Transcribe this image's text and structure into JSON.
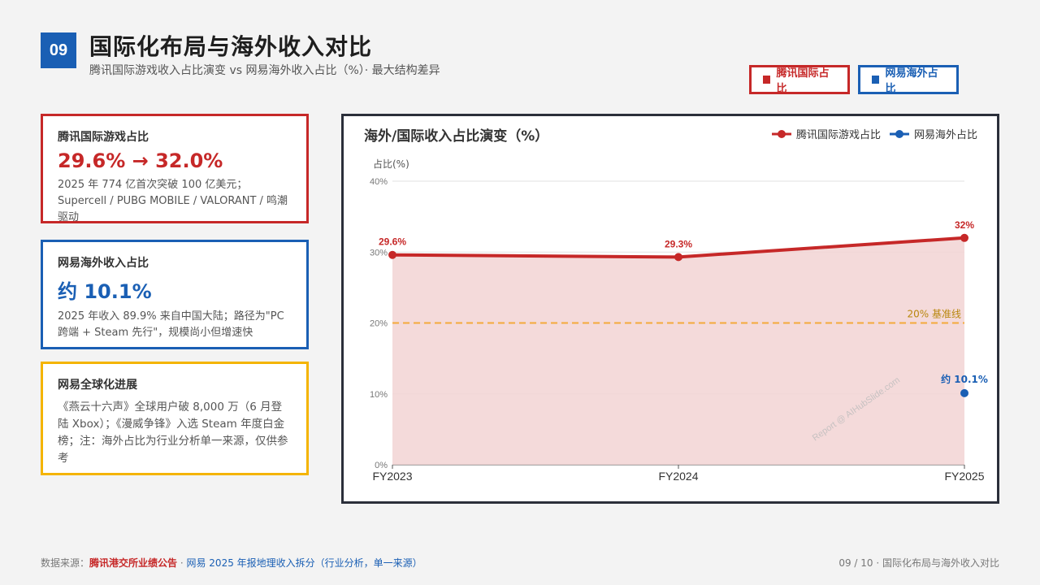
{
  "header": {
    "page_number": "09",
    "title": "国际化布局与海外收入对比",
    "subtitle": "腾讯国际游戏收入占比演变 vs 网易海外收入占比（%）· 最大结构差异"
  },
  "legend_boxes": {
    "tencent": "腾讯国际占比",
    "netease": "网易海外占比"
  },
  "cards": [
    {
      "title": "腾讯国际游戏占比",
      "value": "29.6% → 32.0%",
      "desc": "2025 年 774 亿首次突破 100 亿美元；Supercell / PUBG MOBILE / VALORANT / 鸣潮驱动"
    },
    {
      "title": "网易海外收入占比",
      "value": "约 10.1%",
      "desc": "2025 年收入 89.9% 来自中国大陆；路径为\"PC 跨端 + Steam 先行\"，规模尚小但增速快"
    },
    {
      "title": "网易全球化进展",
      "desc": "《燕云十六声》全球用户破 8,000 万（6 月登陆 Xbox）；《漫威争锋》入选 Steam 年度白金榜；注：海外占比为行业分析单一来源，仅供参考"
    }
  ],
  "chart_data": {
    "type": "line",
    "title": "海外/国际收入占比演变（%）",
    "ylabel": "占比(%)",
    "categories": [
      "FY2023",
      "FY2024",
      "FY2025"
    ],
    "ylim": [
      0,
      40
    ],
    "yticks": [
      "0%",
      "10%",
      "20%",
      "30%",
      "40%"
    ],
    "series": [
      {
        "name": "腾讯国际游戏占比",
        "values": [
          29.6,
          29.3,
          32.0
        ],
        "labels": [
          "29.6%",
          "29.3%",
          "32%"
        ],
        "color": "#c62828",
        "fill": "#f2d4d4"
      },
      {
        "name": "网易海外占比",
        "values": [
          null,
          null,
          10.1
        ],
        "labels": [
          "",
          "",
          "约 10.1%"
        ],
        "color": "#1a5fb4"
      }
    ],
    "reference_line": {
      "value": 20,
      "label": "20% 基准线",
      "color": "#f4a93b"
    },
    "legend_position": "top-right",
    "grid": true
  },
  "watermark": "Report @ AIHubSlide.com",
  "footer": {
    "source_prefix": "数据来源：",
    "source_red": "腾讯港交所业绩公告",
    "source_sep": " · ",
    "source_blue": "网易 2025 年报地理收入拆分（行业分析，单一来源）",
    "right": "09 / 10 · 国际化布局与海外收入对比"
  },
  "colors": {
    "accent_blue": "#1a5fb4",
    "accent_red": "#c62828",
    "accent_yellow": "#f4b400"
  }
}
